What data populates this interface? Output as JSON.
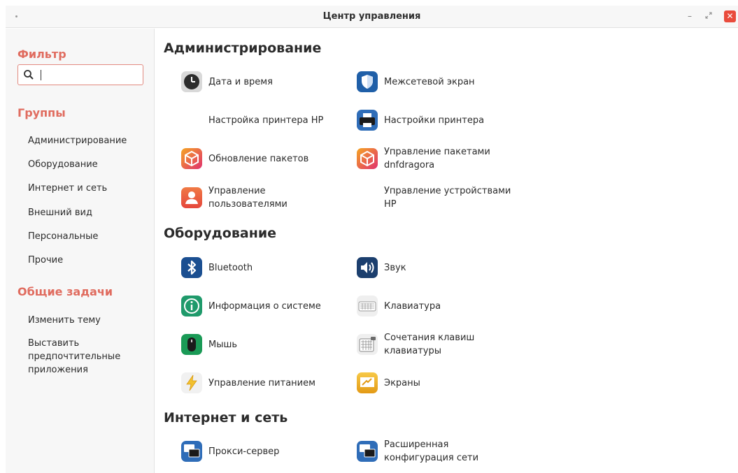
{
  "window": {
    "title": "Центр управления",
    "controls": {
      "minimize": "–",
      "maximize": "⤢",
      "close": "✕"
    }
  },
  "sidebar": {
    "filter_heading": "Фильтр",
    "search": {
      "value": "",
      "placeholder": ""
    },
    "groups_heading": "Группы",
    "groups": [
      "Администрирование",
      "Оборудование",
      "Интернет и сеть",
      "Внешний вид",
      "Персональные",
      "Прочие"
    ],
    "tasks_heading": "Общие задачи",
    "tasks": [
      "Изменить тему",
      "Выставить\nпредпочтительные\nприложения"
    ]
  },
  "sections": [
    {
      "title": "Администрирование",
      "items": [
        {
          "label": "Дата и время",
          "icon": "clock-icon"
        },
        {
          "label": "Межсетевой экран",
          "icon": "firewall-shield-icon"
        },
        {
          "label": "Настройка принтера HP",
          "icon": "none"
        },
        {
          "label": "Настройки принтера",
          "icon": "printer-icon"
        },
        {
          "label": "Обновление пакетов",
          "icon": "package-update-icon"
        },
        {
          "label": "Управление пакетами\ndnfdragora",
          "icon": "package-manager-icon"
        },
        {
          "label": "Управление\nпользователями",
          "icon": "user-icon"
        },
        {
          "label": "Управление устройствами\nHP",
          "icon": "none"
        }
      ]
    },
    {
      "title": "Оборудование",
      "items": [
        {
          "label": "Bluetooth",
          "icon": "bluetooth-icon"
        },
        {
          "label": "Звук",
          "icon": "speaker-icon"
        },
        {
          "label": "Информация о системе",
          "icon": "info-icon"
        },
        {
          "label": "Клавиатура",
          "icon": "keyboard-icon"
        },
        {
          "label": "Мышь",
          "icon": "mouse-icon"
        },
        {
          "label": "Сочетания клавиш\nклавиатуры",
          "icon": "keyboard-shortcuts-icon"
        },
        {
          "label": "Управление питанием",
          "icon": "power-icon"
        },
        {
          "label": "Экраны",
          "icon": "display-icon"
        }
      ]
    },
    {
      "title": "Интернет и сеть",
      "items": [
        {
          "label": "Прокси-сервер",
          "icon": "network-proxy-icon"
        },
        {
          "label": "Расширенная\nконфигурация сети",
          "icon": "network-config-icon"
        }
      ]
    }
  ],
  "colors": {
    "accent": "#e06c5f",
    "sidebar_bg": "#f7f7f7",
    "close_button": "#e94b3c"
  }
}
